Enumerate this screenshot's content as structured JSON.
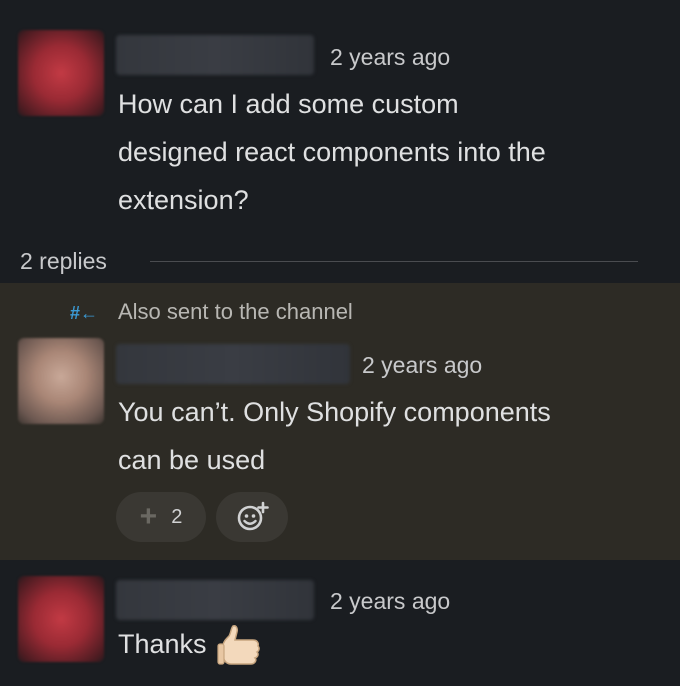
{
  "messages": [
    {
      "timestamp": "2 years ago",
      "text_lines": [
        "How can I add some custom",
        "designed react components into the",
        "extension?"
      ]
    },
    {
      "channel_note": "Also sent to the channel",
      "channel_icon": "#←",
      "timestamp": "2 years ago",
      "text_lines": [
        "You can’t. Only Shopify components",
        "can be used"
      ],
      "reaction": {
        "icon": "plus-icon",
        "count": "2"
      },
      "add_reaction_icon": "add-emoji-icon"
    },
    {
      "timestamp": "2 years ago",
      "text": "Thanks",
      "emoji": "thumbs-up-icon"
    }
  ],
  "thread": {
    "replies_label": "2 replies"
  },
  "colors": {
    "background": "#1a1d21",
    "highlight": "#2d2b25",
    "channel_icon": "#3b9bd6"
  }
}
